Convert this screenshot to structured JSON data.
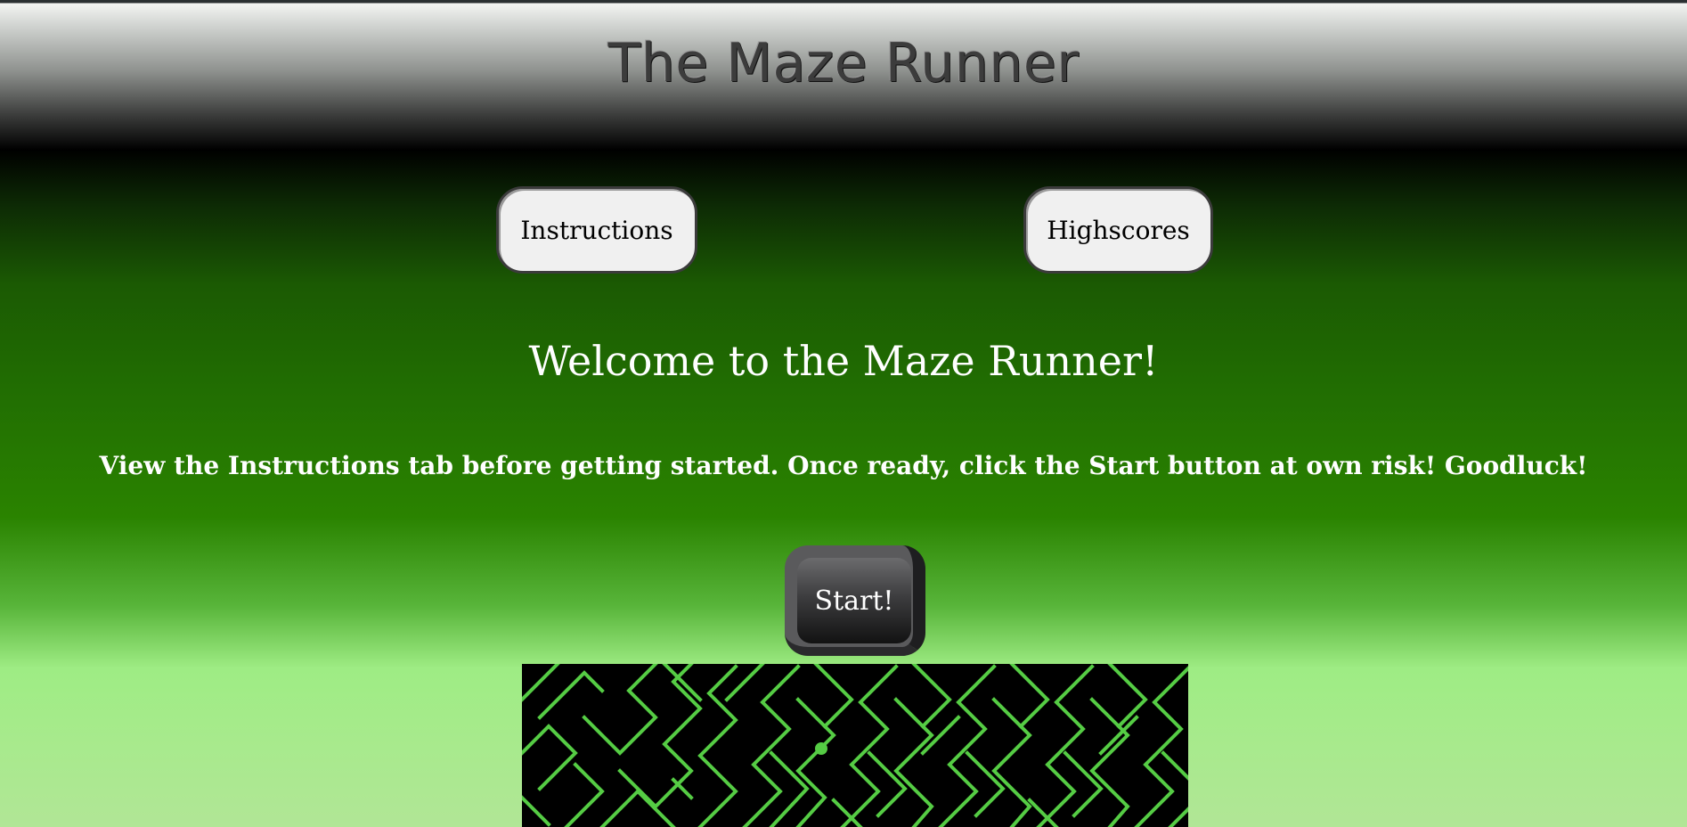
{
  "header": {
    "title": "The Maze Runner"
  },
  "nav": {
    "instructions_label": "Instructions",
    "highscores_label": "Highscores"
  },
  "main": {
    "welcome": "Welcome to the Maze Runner!",
    "subtext": "View the Instructions tab before getting started. Once ready, click the Start button at own risk! Goodluck!",
    "start_label": "Start!"
  },
  "maze": {
    "wall_color": "#55cc44",
    "background_color": "#000000",
    "player_color": "#55cc44"
  }
}
